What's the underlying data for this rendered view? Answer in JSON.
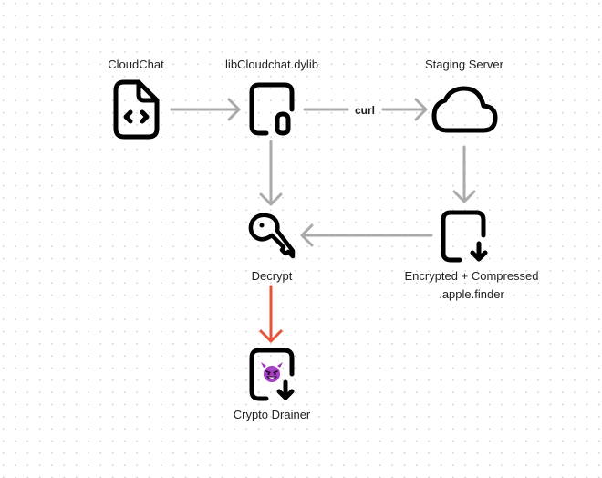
{
  "diagram": {
    "nodes": [
      {
        "id": "cloudchat",
        "label": "CloudChat",
        "icon": "code-file-icon"
      },
      {
        "id": "dylib",
        "label": "libCloudchat.dylib",
        "icon": "paperclip-file-icon"
      },
      {
        "id": "staging",
        "label": "Staging Server",
        "icon": "cloud-icon"
      },
      {
        "id": "decrypt",
        "label": "Decrypt",
        "icon": "key-icon"
      },
      {
        "id": "encrypted",
        "label_line1": "Encrypted + Compressed",
        "label_line2": ".apple.finder",
        "icon": "file-download-icon"
      },
      {
        "id": "drainer",
        "label": "Crypto Drainer",
        "icon": "file-download-icon",
        "badge_icon": "smiling-devil-emoji-icon"
      }
    ],
    "edges": [
      {
        "from": "cloudchat",
        "to": "dylib",
        "label": "",
        "color": "#aaaaaa"
      },
      {
        "from": "dylib",
        "to": "staging",
        "label": "curl",
        "color": "#aaaaaa"
      },
      {
        "from": "dylib",
        "to": "decrypt",
        "label": "",
        "color": "#aaaaaa"
      },
      {
        "from": "staging",
        "to": "encrypted",
        "label": "",
        "color": "#aaaaaa"
      },
      {
        "from": "encrypted",
        "to": "decrypt",
        "label": "",
        "color": "#aaaaaa"
      },
      {
        "from": "decrypt",
        "to": "drainer",
        "label": "",
        "color": "#e4533a"
      }
    ]
  }
}
